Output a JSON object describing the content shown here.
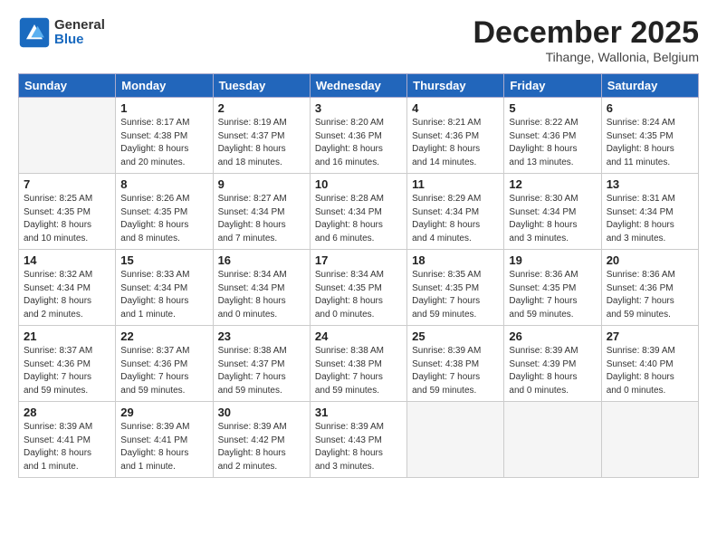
{
  "header": {
    "logo_line1": "General",
    "logo_line2": "Blue",
    "month_title": "December 2025",
    "subtitle": "Tihange, Wallonia, Belgium"
  },
  "days_of_week": [
    "Sunday",
    "Monday",
    "Tuesday",
    "Wednesday",
    "Thursday",
    "Friday",
    "Saturday"
  ],
  "weeks": [
    [
      {
        "day": "",
        "text": ""
      },
      {
        "day": "1",
        "text": "Sunrise: 8:17 AM\nSunset: 4:38 PM\nDaylight: 8 hours\nand 20 minutes."
      },
      {
        "day": "2",
        "text": "Sunrise: 8:19 AM\nSunset: 4:37 PM\nDaylight: 8 hours\nand 18 minutes."
      },
      {
        "day": "3",
        "text": "Sunrise: 8:20 AM\nSunset: 4:36 PM\nDaylight: 8 hours\nand 16 minutes."
      },
      {
        "day": "4",
        "text": "Sunrise: 8:21 AM\nSunset: 4:36 PM\nDaylight: 8 hours\nand 14 minutes."
      },
      {
        "day": "5",
        "text": "Sunrise: 8:22 AM\nSunset: 4:36 PM\nDaylight: 8 hours\nand 13 minutes."
      },
      {
        "day": "6",
        "text": "Sunrise: 8:24 AM\nSunset: 4:35 PM\nDaylight: 8 hours\nand 11 minutes."
      }
    ],
    [
      {
        "day": "7",
        "text": "Sunrise: 8:25 AM\nSunset: 4:35 PM\nDaylight: 8 hours\nand 10 minutes."
      },
      {
        "day": "8",
        "text": "Sunrise: 8:26 AM\nSunset: 4:35 PM\nDaylight: 8 hours\nand 8 minutes."
      },
      {
        "day": "9",
        "text": "Sunrise: 8:27 AM\nSunset: 4:34 PM\nDaylight: 8 hours\nand 7 minutes."
      },
      {
        "day": "10",
        "text": "Sunrise: 8:28 AM\nSunset: 4:34 PM\nDaylight: 8 hours\nand 6 minutes."
      },
      {
        "day": "11",
        "text": "Sunrise: 8:29 AM\nSunset: 4:34 PM\nDaylight: 8 hours\nand 4 minutes."
      },
      {
        "day": "12",
        "text": "Sunrise: 8:30 AM\nSunset: 4:34 PM\nDaylight: 8 hours\nand 3 minutes."
      },
      {
        "day": "13",
        "text": "Sunrise: 8:31 AM\nSunset: 4:34 PM\nDaylight: 8 hours\nand 3 minutes."
      }
    ],
    [
      {
        "day": "14",
        "text": "Sunrise: 8:32 AM\nSunset: 4:34 PM\nDaylight: 8 hours\nand 2 minutes."
      },
      {
        "day": "15",
        "text": "Sunrise: 8:33 AM\nSunset: 4:34 PM\nDaylight: 8 hours\nand 1 minute."
      },
      {
        "day": "16",
        "text": "Sunrise: 8:34 AM\nSunset: 4:34 PM\nDaylight: 8 hours\nand 0 minutes."
      },
      {
        "day": "17",
        "text": "Sunrise: 8:34 AM\nSunset: 4:35 PM\nDaylight: 8 hours\nand 0 minutes."
      },
      {
        "day": "18",
        "text": "Sunrise: 8:35 AM\nSunset: 4:35 PM\nDaylight: 7 hours\nand 59 minutes."
      },
      {
        "day": "19",
        "text": "Sunrise: 8:36 AM\nSunset: 4:35 PM\nDaylight: 7 hours\nand 59 minutes."
      },
      {
        "day": "20",
        "text": "Sunrise: 8:36 AM\nSunset: 4:36 PM\nDaylight: 7 hours\nand 59 minutes."
      }
    ],
    [
      {
        "day": "21",
        "text": "Sunrise: 8:37 AM\nSunset: 4:36 PM\nDaylight: 7 hours\nand 59 minutes."
      },
      {
        "day": "22",
        "text": "Sunrise: 8:37 AM\nSunset: 4:36 PM\nDaylight: 7 hours\nand 59 minutes."
      },
      {
        "day": "23",
        "text": "Sunrise: 8:38 AM\nSunset: 4:37 PM\nDaylight: 7 hours\nand 59 minutes."
      },
      {
        "day": "24",
        "text": "Sunrise: 8:38 AM\nSunset: 4:38 PM\nDaylight: 7 hours\nand 59 minutes."
      },
      {
        "day": "25",
        "text": "Sunrise: 8:39 AM\nSunset: 4:38 PM\nDaylight: 7 hours\nand 59 minutes."
      },
      {
        "day": "26",
        "text": "Sunrise: 8:39 AM\nSunset: 4:39 PM\nDaylight: 8 hours\nand 0 minutes."
      },
      {
        "day": "27",
        "text": "Sunrise: 8:39 AM\nSunset: 4:40 PM\nDaylight: 8 hours\nand 0 minutes."
      }
    ],
    [
      {
        "day": "28",
        "text": "Sunrise: 8:39 AM\nSunset: 4:41 PM\nDaylight: 8 hours\nand 1 minute."
      },
      {
        "day": "29",
        "text": "Sunrise: 8:39 AM\nSunset: 4:41 PM\nDaylight: 8 hours\nand 1 minute."
      },
      {
        "day": "30",
        "text": "Sunrise: 8:39 AM\nSunset: 4:42 PM\nDaylight: 8 hours\nand 2 minutes."
      },
      {
        "day": "31",
        "text": "Sunrise: 8:39 AM\nSunset: 4:43 PM\nDaylight: 8 hours\nand 3 minutes."
      },
      {
        "day": "",
        "text": ""
      },
      {
        "day": "",
        "text": ""
      },
      {
        "day": "",
        "text": ""
      }
    ]
  ]
}
